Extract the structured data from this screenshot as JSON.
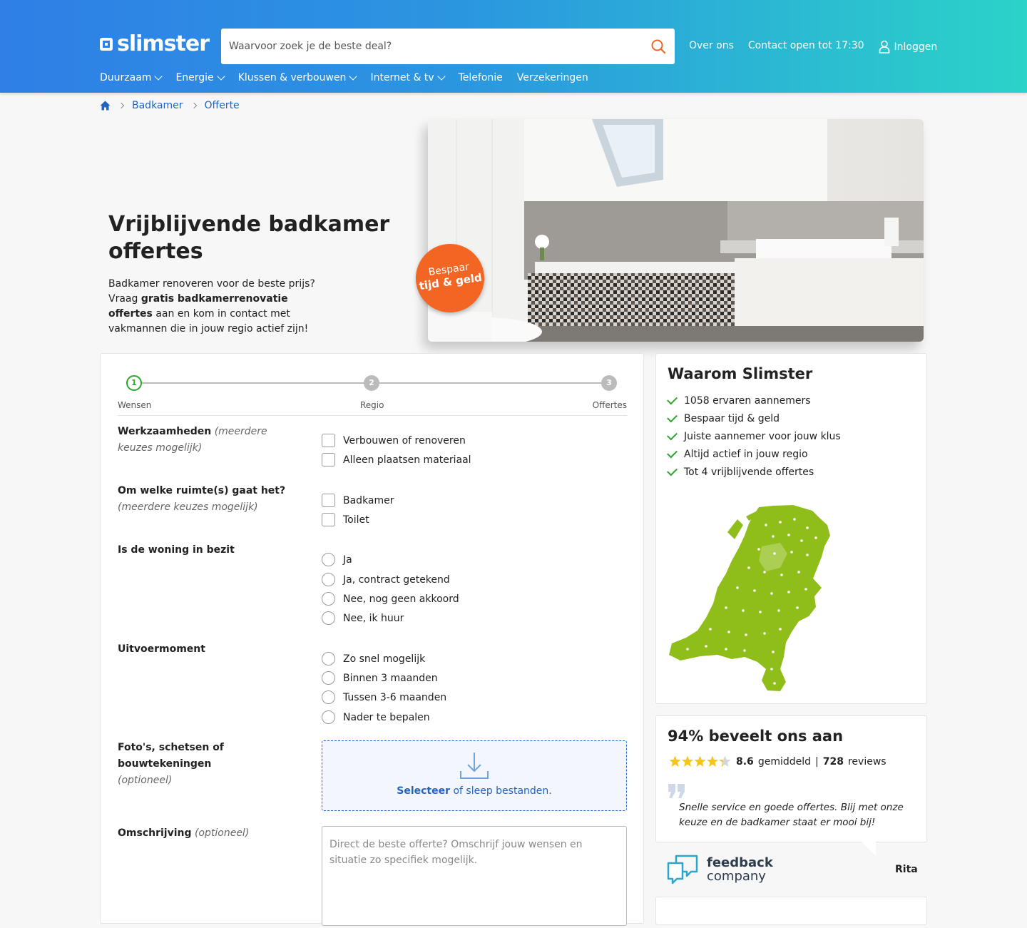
{
  "header": {
    "logo": "slimster",
    "search_placeholder": "Waarvoor zoek je de beste deal?",
    "links": [
      "Over ons",
      "Contact open tot 17:30"
    ],
    "login": "Inloggen",
    "nav": [
      {
        "label": "Duurzaam",
        "dropdown": true
      },
      {
        "label": "Energie",
        "dropdown": true
      },
      {
        "label": "Klussen & verbouwen",
        "dropdown": true
      },
      {
        "label": "Internet & tv",
        "dropdown": true
      },
      {
        "label": "Telefonie",
        "dropdown": false
      },
      {
        "label": "Verzekeringen",
        "dropdown": false
      }
    ]
  },
  "breadcrumb": [
    "Badkamer",
    "Offerte"
  ],
  "hero": {
    "title": "Vrijblijvende badkamer offertes",
    "text_1": "Badkamer renoveren voor de beste prijs? Vraag ",
    "text_bold": "gratis badkamerrenovatie offertes",
    "text_2": " aan en kom in contact met vakmannen die in jouw regio actief zijn!",
    "badge_1": "Bespaar",
    "badge_2": "tijd & geld"
  },
  "steps": [
    {
      "num": "1",
      "label": "Wensen",
      "active": true
    },
    {
      "num": "2",
      "label": "Regio",
      "active": false
    },
    {
      "num": "3",
      "label": "Offertes",
      "active": false
    }
  ],
  "form": {
    "q1_label": "Werkzaamheden",
    "q1_hint": "(meerdere keuzes mogelijk)",
    "q1_options": [
      "Verbouwen of renoveren",
      "Alleen plaatsen materiaal"
    ],
    "q2_label": "Om welke ruimte(s) gaat het?",
    "q2_hint": "(meerdere keuzes mogelijk)",
    "q2_options": [
      "Badkamer",
      "Toilet"
    ],
    "q3_label": "Is de woning in bezit",
    "q3_options": [
      "Ja",
      "Ja, contract getekend",
      "Nee, nog geen akkoord",
      "Nee, ik huur"
    ],
    "q4_label": "Uitvoermoment",
    "q4_options": [
      "Zo snel mogelijk",
      "Binnen 3 maanden",
      "Tussen 3-6 maanden",
      "Nader te bepalen"
    ],
    "q5_label": "Foto's, schetsen of bouwtekeningen",
    "q5_hint": "(optioneel)",
    "upload_link": "Selecteer",
    "upload_text": " of sleep bestanden.",
    "q6_label": "Omschrijving",
    "q6_hint": "(optioneel)",
    "description_placeholder": "Direct de beste offerte? Omschrijf jouw wensen en situatie zo specifiek mogelijk."
  },
  "why": {
    "title": "Waarom Slimster",
    "items": [
      "1058 ervaren aannemers",
      "Bespaar tijd & geld",
      "Juiste aannemer voor jouw klus",
      "Altijd actief in jouw regio",
      "Tot 4 vrijblijvende offertes"
    ]
  },
  "reviews": {
    "title": "94% beveelt ons aan",
    "rating": "8.6",
    "rating_label": "gemiddeld",
    "separator": "|",
    "count": "728",
    "count_label": "reviews",
    "stars_filled": 4.3,
    "quote": "Snelle service en goede offertes. Blij met onze keuze en de badkamer staat er mooi bij!",
    "name": "Rita",
    "provider_1": "feedback",
    "provider_2": "company"
  },
  "colors": {
    "accent": "#f26522",
    "link": "#1f63c4",
    "success": "#2ba52b",
    "map": "#8fbe1a"
  }
}
